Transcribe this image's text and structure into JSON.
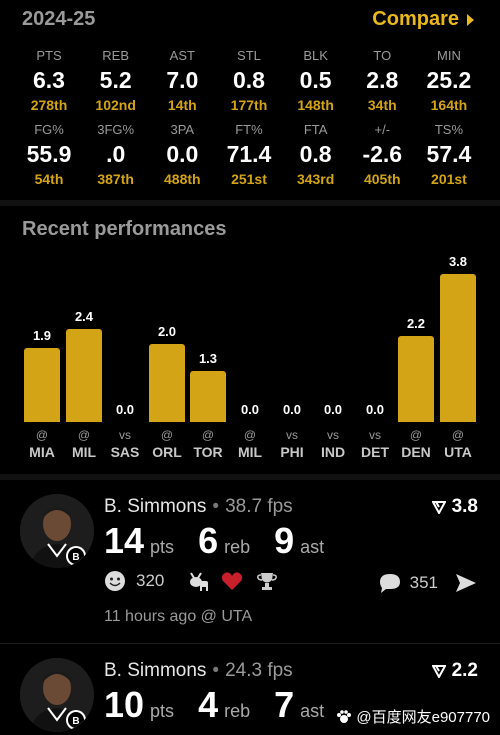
{
  "header": {
    "season": "2024-25",
    "compare": "Compare"
  },
  "stats_row1": [
    {
      "label": "PTS",
      "value": "6.3",
      "rank": "278th"
    },
    {
      "label": "REB",
      "value": "5.2",
      "rank": "102nd"
    },
    {
      "label": "AST",
      "value": "7.0",
      "rank": "14th"
    },
    {
      "label": "STL",
      "value": "0.8",
      "rank": "177th"
    },
    {
      "label": "BLK",
      "value": "0.5",
      "rank": "148th"
    },
    {
      "label": "TO",
      "value": "2.8",
      "rank": "34th"
    },
    {
      "label": "MIN",
      "value": "25.2",
      "rank": "164th"
    }
  ],
  "stats_row2": [
    {
      "label": "FG%",
      "value": "55.9",
      "rank": "54th"
    },
    {
      "label": "3FG%",
      "value": ".0",
      "rank": "387th"
    },
    {
      "label": "3PA",
      "value": "0.0",
      "rank": "488th"
    },
    {
      "label": "FT%",
      "value": "71.4",
      "rank": "251st"
    },
    {
      "label": "FTA",
      "value": "0.8",
      "rank": "343rd"
    },
    {
      "label": "+/-",
      "value": "-2.6",
      "rank": "405th"
    },
    {
      "label": "TS%",
      "value": "57.4",
      "rank": "201st"
    }
  ],
  "recent": {
    "title": "Recent performances"
  },
  "chart_data": {
    "type": "bar",
    "title": "Recent performances",
    "categories": [
      "MIA",
      "MIL",
      "SAS",
      "ORL",
      "TOR",
      "MIL",
      "PHI",
      "IND",
      "DET",
      "DEN",
      "UTA"
    ],
    "prefixes": [
      "@",
      "@",
      "vs",
      "@",
      "@",
      "@",
      "vs",
      "vs",
      "vs",
      "@",
      "@"
    ],
    "values": [
      1.9,
      2.4,
      0.0,
      2.0,
      1.3,
      0.0,
      0.0,
      0.0,
      0.0,
      2.2,
      3.8
    ],
    "labels": [
      "1.9",
      "2.4",
      "0.0",
      "2.0",
      "1.3",
      "0.0",
      "0.0",
      "0.0",
      "0.0",
      "2.2",
      "3.8"
    ],
    "ylim": [
      0,
      3.8
    ],
    "bar_color": "#d4a417"
  },
  "games": [
    {
      "name": "B. Simmons",
      "fps": "38.7 fps",
      "score": "3.8",
      "pts": "14",
      "pts_unit": "pts",
      "reb": "6",
      "reb_unit": "reb",
      "ast": "9",
      "ast_unit": "ast",
      "reactions": "320",
      "comments": "351",
      "time": "11 hours ago @ UTA"
    },
    {
      "name": "B. Simmons",
      "fps": "24.3 fps",
      "score": "2.2",
      "pts": "10",
      "pts_unit": "pts",
      "reb": "4",
      "reb_unit": "reb",
      "ast": "7",
      "ast_unit": "ast"
    }
  ],
  "watermark": "@百度网友e907770",
  "colors": {
    "accent": "#e9b81a",
    "rank": "#d4a417",
    "background": "#000000"
  },
  "icons": [
    "caret-right-icon",
    "smiley-icon",
    "goat-icon",
    "heart-icon",
    "trophy-icon",
    "comment-icon",
    "share-icon",
    "score-icon",
    "nets-logo-icon"
  ]
}
